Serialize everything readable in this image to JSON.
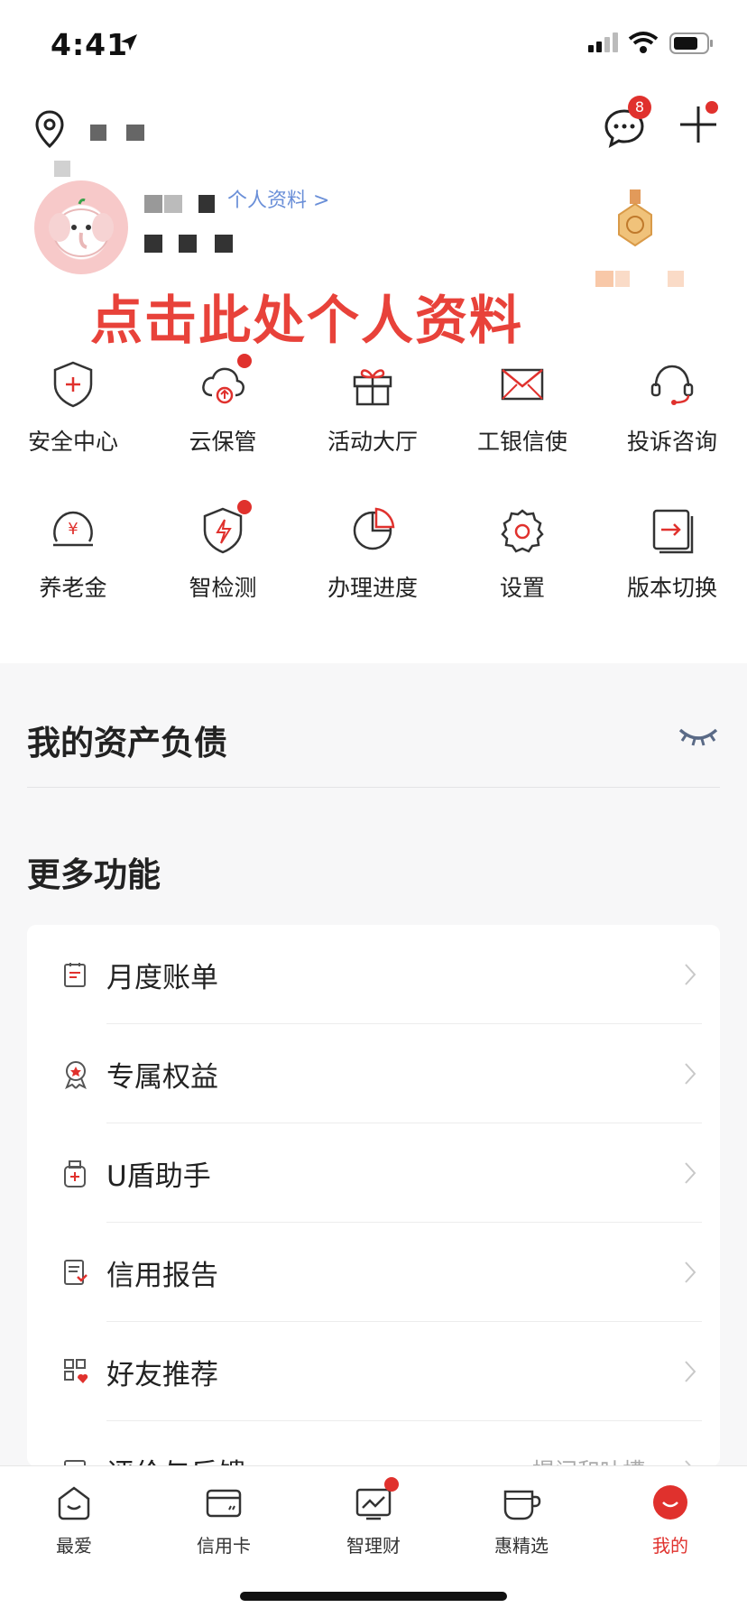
{
  "status_bar": {
    "time": "4:41"
  },
  "header": {
    "message_badge": "8"
  },
  "profile": {
    "link_label": "个人资料 >",
    "promo_text": "点击此处个人资料"
  },
  "grid_row1": [
    {
      "label": "安全中心",
      "icon": "shield-plus-icon",
      "dot": false
    },
    {
      "label": "云保管",
      "icon": "cloud-upload-icon",
      "dot": true
    },
    {
      "label": "活动大厅",
      "icon": "gift-icon",
      "dot": false
    },
    {
      "label": "工银信使",
      "icon": "envelope-icon",
      "dot": false
    },
    {
      "label": "投诉咨询",
      "icon": "headset-icon",
      "dot": false
    }
  ],
  "grid_row2": [
    {
      "label": "养老金",
      "icon": "yuan-coin-icon",
      "dot": false
    },
    {
      "label": "智检测",
      "icon": "shield-bolt-icon",
      "dot": true
    },
    {
      "label": "办理进度",
      "icon": "pie-progress-icon",
      "dot": false
    },
    {
      "label": "设置",
      "icon": "gear-icon",
      "dot": false
    },
    {
      "label": "版本切换",
      "icon": "switch-arrow-icon",
      "dot": false
    }
  ],
  "assets": {
    "title": "我的资产负债"
  },
  "more": {
    "title": "更多功能",
    "items": [
      {
        "label": "月度账单",
        "icon": "bill-icon"
      },
      {
        "label": "专属权益",
        "icon": "badge-icon"
      },
      {
        "label": "U盾助手",
        "icon": "ukey-icon"
      },
      {
        "label": "信用报告",
        "icon": "report-icon"
      },
      {
        "label": "好友推荐",
        "icon": "qr-share-icon"
      },
      {
        "label": "评价与反馈",
        "icon": "feedback-icon",
        "hint": "提问和吐槽"
      }
    ]
  },
  "tabs": [
    {
      "label": "最爱",
      "icon": "smile-home-icon",
      "active": false,
      "dot": false
    },
    {
      "label": "信用卡",
      "icon": "credit-card-icon",
      "active": false,
      "dot": false
    },
    {
      "label": "智理财",
      "icon": "chart-line-icon",
      "active": false,
      "dot": true
    },
    {
      "label": "惠精选",
      "icon": "cup-icon",
      "active": false,
      "dot": false
    },
    {
      "label": "我的",
      "icon": "smile-circle-icon",
      "active": true,
      "dot": false
    }
  ],
  "colors": {
    "accent": "#e0312d",
    "link": "#6a8fd8",
    "promo": "#e8423a"
  }
}
